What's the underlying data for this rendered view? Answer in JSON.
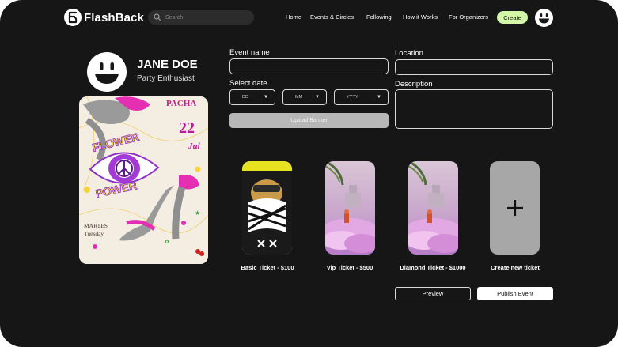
{
  "brand": {
    "name": "FlashBack"
  },
  "search": {
    "placeholder": "Search"
  },
  "nav": {
    "links": [
      "Home",
      "Events & Circles",
      "Following",
      "How it Works",
      "For Organizers"
    ],
    "create_label": "Create"
  },
  "profile": {
    "name": "JANE DOE",
    "role": "Party Enthusiast"
  },
  "poster": {
    "venue": "PACHA",
    "day": "22",
    "month": "Jul",
    "line1": "FLOWER",
    "line2": "POWER",
    "weekday_line1": "MARTES",
    "weekday_line2": "Tuesday"
  },
  "form": {
    "event_name_label": "Event name",
    "event_name_value": "",
    "location_label": "Location",
    "location_value": "",
    "select_date_label": "Select date",
    "date_day": "DD",
    "date_month": "MM",
    "date_year": "YYYY",
    "description_label": "Description",
    "description_value": "",
    "upload_banner_label": "Upload Banner"
  },
  "tickets": [
    {
      "label": "Basic Ticket - $100"
    },
    {
      "label": "Vip Ticket - $500"
    },
    {
      "label": "Diamond Ticket - $1000"
    }
  ],
  "new_ticket": {
    "label": "Create new ticket"
  },
  "actions": {
    "preview_label": "Preview",
    "publish_label": "Publish Event"
  },
  "colors": {
    "background": "#161616",
    "accent": "#d3f7a8",
    "upload": "#b7b7b7",
    "add_tile": "#a7a7a7",
    "poster_pink": "#e52fb3"
  }
}
